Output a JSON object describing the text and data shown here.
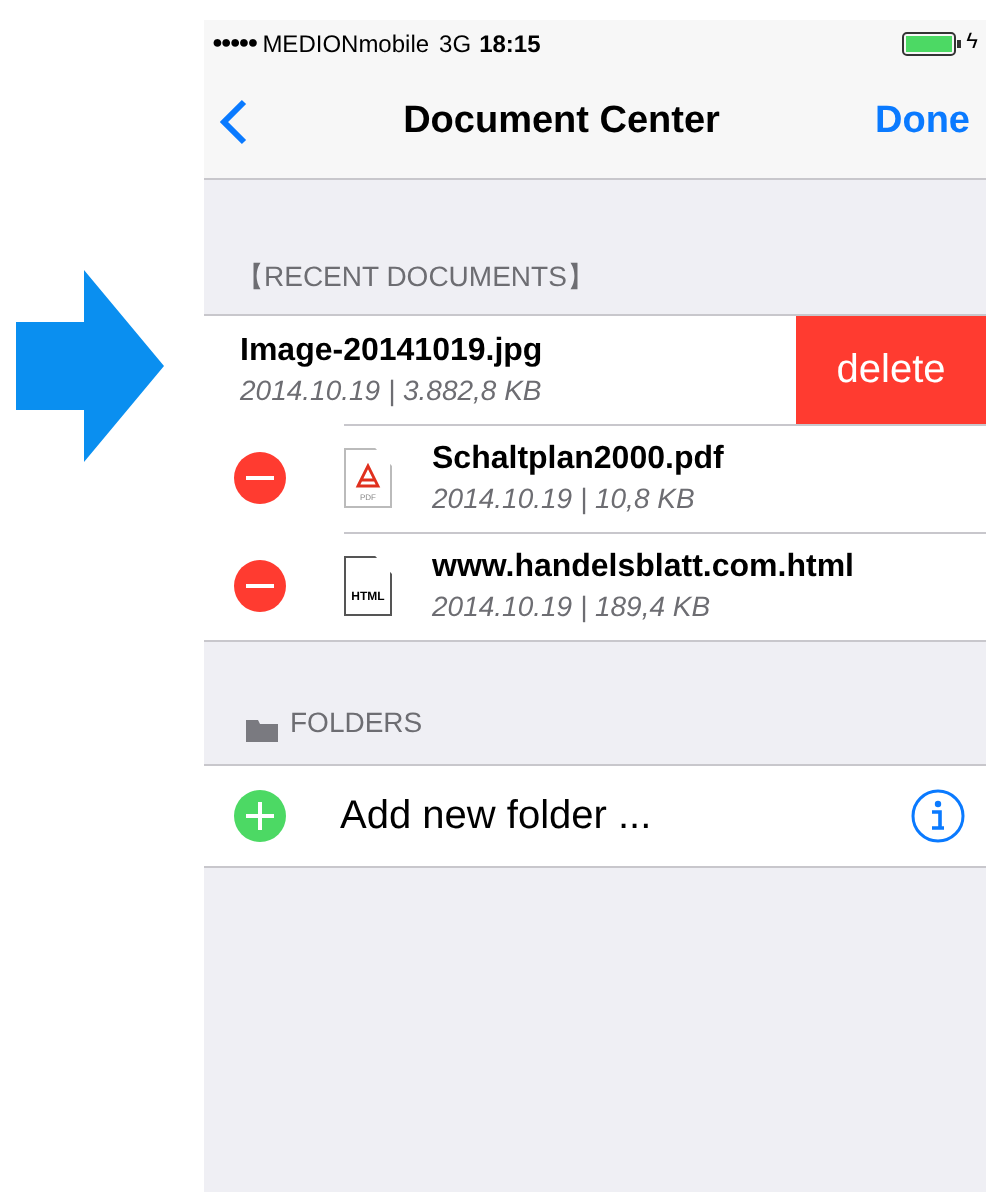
{
  "status_bar": {
    "signal_dots": "●●●●●",
    "carrier": "MEDIONmobile",
    "network": "3G",
    "time": "18:15",
    "charging_icon": "ϟ"
  },
  "nav_bar": {
    "title": "Document Center",
    "done": "Done"
  },
  "recent_section": {
    "header": "【RECENT DOCUMENTS】",
    "documents": [
      {
        "name": "Image-20141019.jpg",
        "meta": "2014.10.19 | 3.882,8 KB",
        "swiped": true,
        "delete_label": "delete"
      },
      {
        "name": "Schaltplan2000.pdf",
        "meta": "2014.10.19 | 10,8 KB",
        "swiped": false,
        "kind": "pdf",
        "icon_label": "PDF"
      },
      {
        "name": "www.handelsblatt.com.html",
        "meta": "2014.10.19 | 189,4 KB",
        "swiped": false,
        "kind": "html",
        "icon_label": "HTML"
      }
    ]
  },
  "folders_section": {
    "header": "FOLDERS",
    "add_label": "Add new folder ..."
  }
}
